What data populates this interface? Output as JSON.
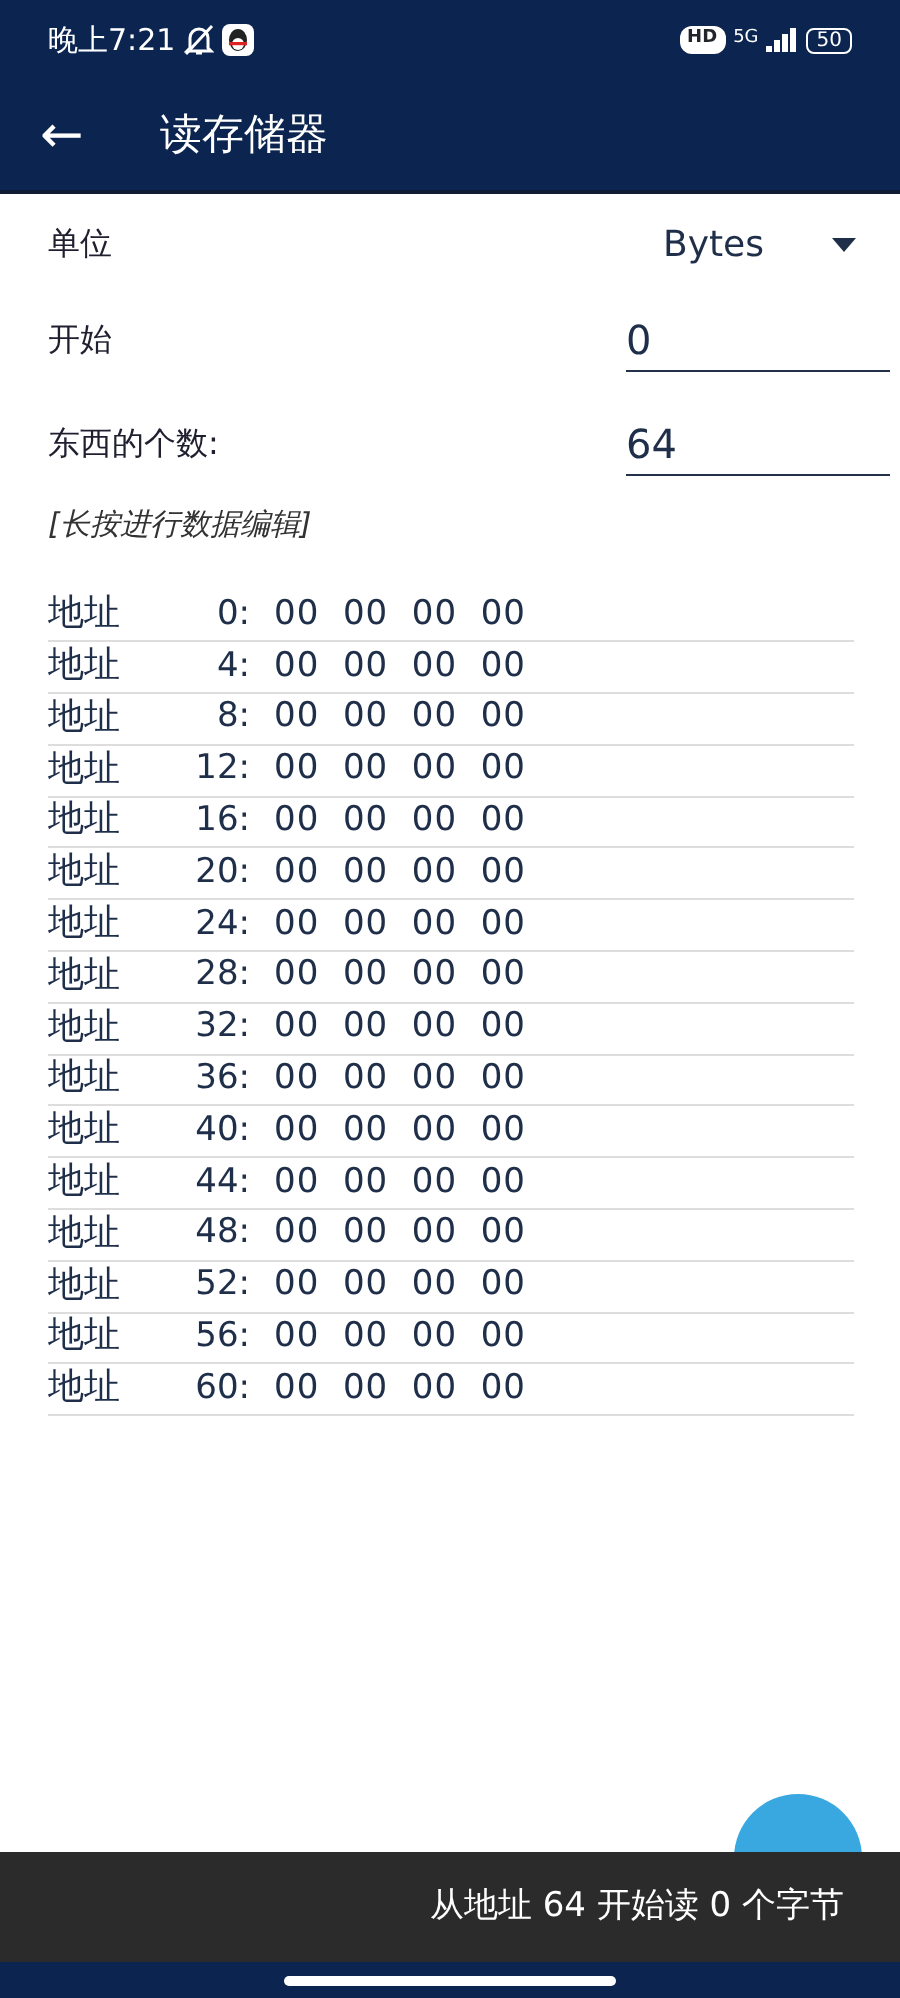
{
  "status_bar": {
    "time": "晚上7:21",
    "hd": "HD",
    "network": "5G",
    "battery": "50"
  },
  "app_bar": {
    "back": "←",
    "title": "读存储器"
  },
  "form": {
    "unit_label": "单位",
    "unit_value": "Bytes",
    "start_label": "开始",
    "start_value": "0",
    "count_label": "东西的个数:",
    "count_value": "64",
    "hint": "[长按进行数据编辑]"
  },
  "memory_rows": [
    {
      "label": "地址",
      "address": "0:",
      "bytes": [
        "00",
        "00",
        "00",
        "00"
      ]
    },
    {
      "label": "地址",
      "address": "4:",
      "bytes": [
        "00",
        "00",
        "00",
        "00"
      ]
    },
    {
      "label": "地址",
      "address": "8:",
      "bytes": [
        "00",
        "00",
        "00",
        "00"
      ]
    },
    {
      "label": "地址",
      "address": "12:",
      "bytes": [
        "00",
        "00",
        "00",
        "00"
      ]
    },
    {
      "label": "地址",
      "address": "16:",
      "bytes": [
        "00",
        "00",
        "00",
        "00"
      ]
    },
    {
      "label": "地址",
      "address": "20:",
      "bytes": [
        "00",
        "00",
        "00",
        "00"
      ]
    },
    {
      "label": "地址",
      "address": "24:",
      "bytes": [
        "00",
        "00",
        "00",
        "00"
      ]
    },
    {
      "label": "地址",
      "address": "28:",
      "bytes": [
        "00",
        "00",
        "00",
        "00"
      ]
    },
    {
      "label": "地址",
      "address": "32:",
      "bytes": [
        "00",
        "00",
        "00",
        "00"
      ]
    },
    {
      "label": "地址",
      "address": "36:",
      "bytes": [
        "00",
        "00",
        "00",
        "00"
      ]
    },
    {
      "label": "地址",
      "address": "40:",
      "bytes": [
        "00",
        "00",
        "00",
        "00"
      ]
    },
    {
      "label": "地址",
      "address": "44:",
      "bytes": [
        "00",
        "00",
        "00",
        "00"
      ]
    },
    {
      "label": "地址",
      "address": "48:",
      "bytes": [
        "00",
        "00",
        "00",
        "00"
      ]
    },
    {
      "label": "地址",
      "address": "52:",
      "bytes": [
        "00",
        "00",
        "00",
        "00"
      ]
    },
    {
      "label": "地址",
      "address": "56:",
      "bytes": [
        "00",
        "00",
        "00",
        "00"
      ]
    },
    {
      "label": "地址",
      "address": "60:",
      "bytes": [
        "00",
        "00",
        "00",
        "00"
      ]
    }
  ],
  "snackbar": {
    "message": "从地址 64 开始读 0 个字节"
  }
}
